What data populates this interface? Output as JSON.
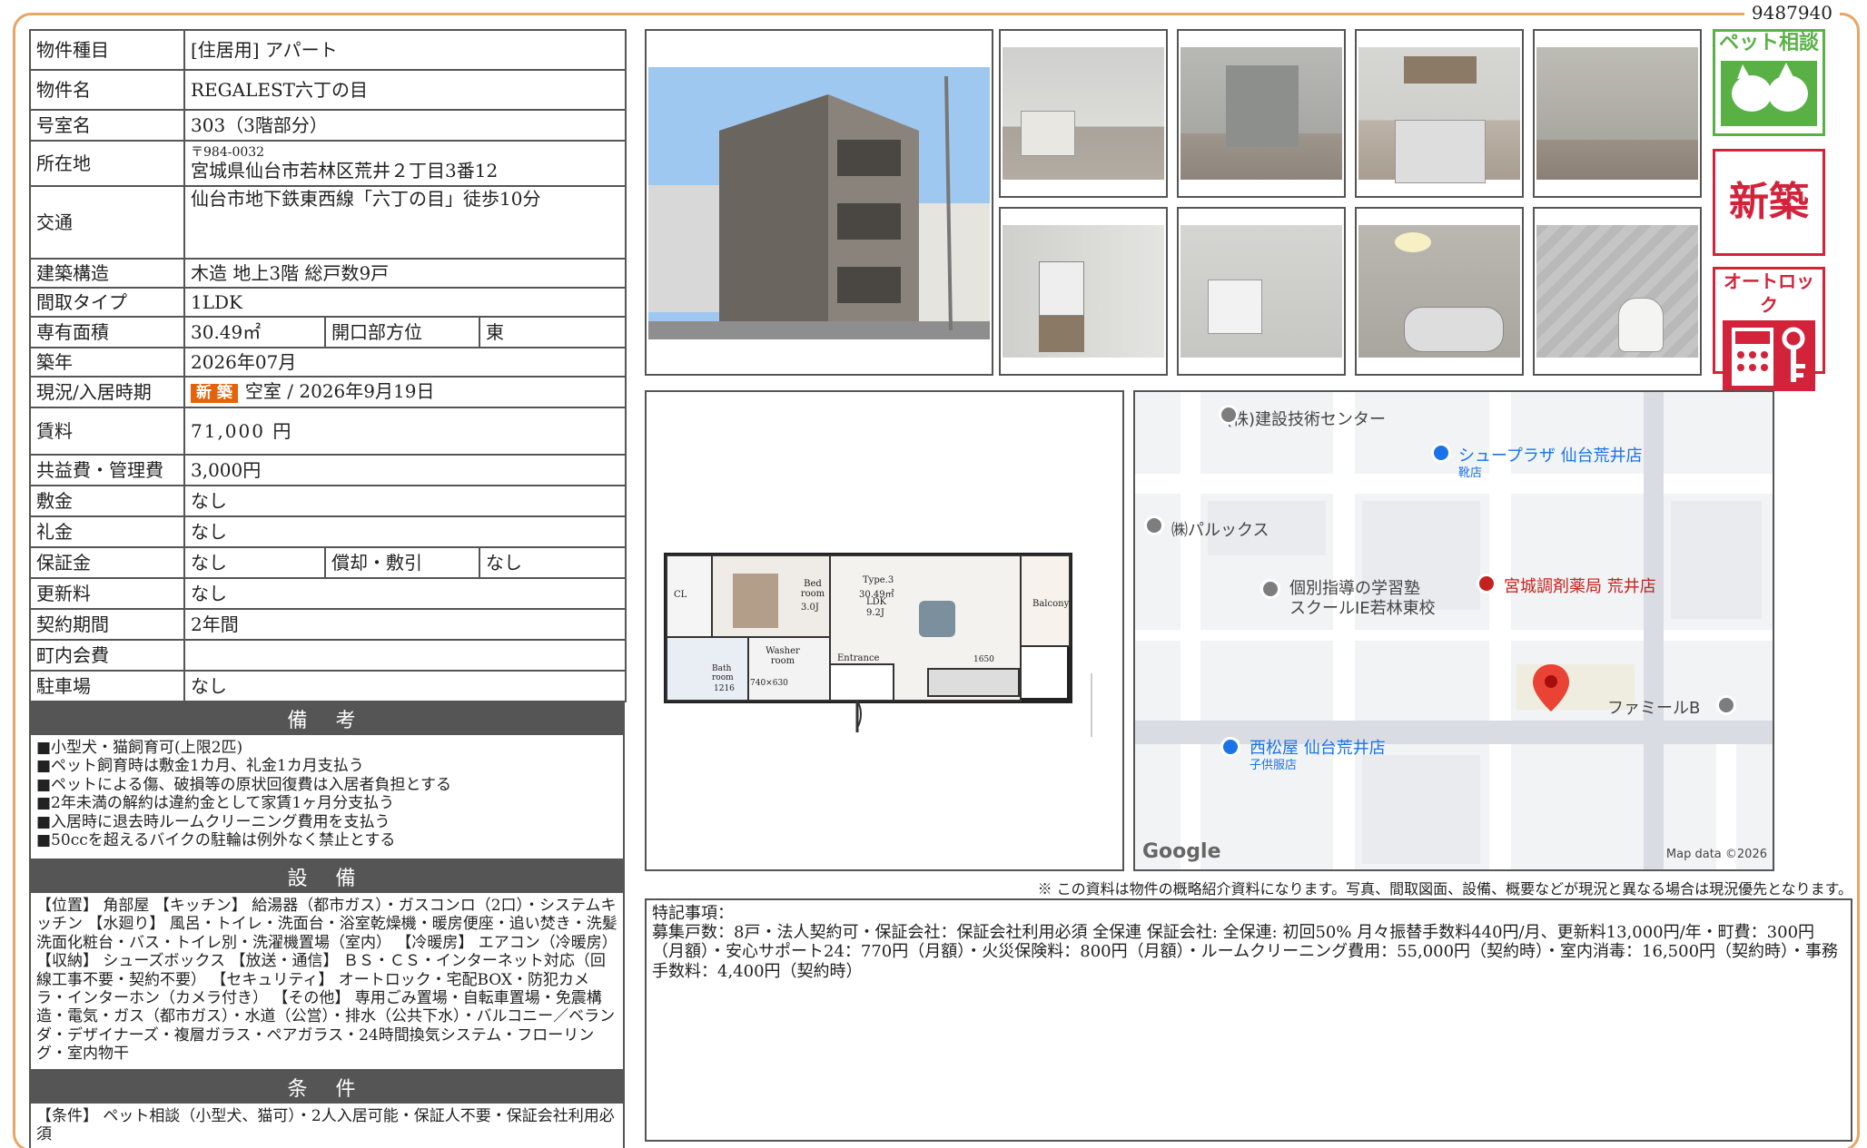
{
  "doc_id": "9487940",
  "table": {
    "type_label": "物件種目",
    "type_value": "[住居用] アパート",
    "name_label": "物件名",
    "name_value": "REGALEST六丁の目",
    "room_label": "号室名",
    "room_value": "303（3階部分）",
    "address_label": "所在地",
    "zip": "〒984-0032",
    "address": "宮城県仙台市若林区荒井２丁目3番12",
    "access_label": "交通",
    "access": "仙台市地下鉄東西線「六丁の目」徒歩10分",
    "structure_label": "建築構造",
    "structure": "木造 地上3階 総戸数9戸",
    "layout_label": "間取タイプ",
    "layout": "1LDK",
    "area_label": "専有面積",
    "area": "30.49㎡",
    "facing_label": "開口部方位",
    "facing": "東",
    "built_label": "築年",
    "built": "2026年07月",
    "status_label": "現況/入居時期",
    "status_badge": "新 築",
    "status": "空室 /  2026年9月19日",
    "rent_label": "賃料",
    "rent": "71,000 円",
    "fee_label": "共益費・管理費",
    "fee": "3,000円",
    "deposit_label": "敷金",
    "deposit": "なし",
    "key_money_label": "礼金",
    "key_money": "なし",
    "guarantee_label": "保証金",
    "guarantee": "なし",
    "amort_label": "償却・敷引",
    "amort": "なし",
    "renewal_label": "更新料",
    "renewal": "なし",
    "contract_label": "契約期間",
    "contract": "2年間",
    "town_fee_label": "町内会費",
    "town_fee": "",
    "parking_label": "駐車場",
    "parking": "なし"
  },
  "biko": {
    "title": "備 考",
    "lines": [
      "■小型犬・猫飼育可(上限2匹)",
      "■ペット飼育時は敷金1カ月、礼金1カ月支払う",
      "■ペットによる傷、破損等の原状回復費は入居者負担とする",
      "■2年未満の解約は違約金として家賃1ヶ月分支払う",
      "■入居時に退去時ルームクリーニング費用を支払う",
      "■50ccを超えるバイクの駐輪は例外なく禁止とする"
    ]
  },
  "setsubi": {
    "title": "設 備",
    "text": "【位置】 角部屋 【キッチン】 給湯器（都市ガス）・ガスコンロ（2口）・システムキッチン 【水廻り】 風呂・トイレ・洗面台・浴室乾燥機・暖房便座・追い焚き・洗髪洗面化粧台・バス・トイレ別・洗濯機置場（室内） 【冷暖房】 エアコン（冷暖房） 【収納】 シューズボックス 【放送・通信】 ＢＳ・ＣＳ・インターネット対応（回線工事不要・契約不要） 【セキュリティ】 オートロック・宅配BOX・防犯カメラ・インターホン（カメラ付き） 【その他】 専用ごみ置場・自転車置場・免震構造・電気・ガス（都市ガス）・水道（公営）・排水（公共下水）・バルコニー／ベランダ・デザイナーズ・複層ガラス・ペアガラス・24時間換気システム・フローリング・室内物干"
  },
  "jouken": {
    "title": "条 件",
    "text": "【条件】 ペット相談（小型犬、猫可）・2人入居可能・保証人不要・保証会社利用必須"
  },
  "badges": {
    "pet": "ペット相談",
    "new": "新築",
    "autolock": "オートロック"
  },
  "floorplan": {
    "type": "Type.3",
    "area": "30.49㎡",
    "ldk": "LDK",
    "ldk_size": "9.2J",
    "bed": "Bed room",
    "bed_size": "3.0J",
    "cl": "CL",
    "washer": "Washer room",
    "entrance": "Entrance",
    "bath": "Bath room",
    "balcony": "Balcony",
    "dim1": "1650",
    "dim2": "1216",
    "dim3": "740×630"
  },
  "map": {
    "labels": {
      "kensetsu": "(株)建設技術センター",
      "shoe": "シュープラザ 仙台荒井店",
      "shoe_sub": "靴店",
      "paruccs": "㈱パルックス",
      "juku1": "個別指導の学習塾",
      "juku2": "スクールIE若林東校",
      "pharmacy": "宮城調剤薬局 荒井店",
      "famil": "ファミールB",
      "nishimatsu": "西松屋 仙台荒井店",
      "nishimatsu_sub": "子供服店",
      "google": "Google",
      "mapdata": "Map data ©2026"
    }
  },
  "note": "※ この資料は物件の概略紹介資料になります。写真、間取図面、設備、概要などが現況と異なる場合は現況優先となります。",
  "remarks": {
    "title": "特記事項：",
    "text": "募集戸数：8戸・法人契約可・保証会社：保証会社利用必須 全保連 保証会社: 全保連: 初回50% 月々振替手数料440円/月、更新料13,000円/年・町費：300円（月額）・安心サポート24：770円（月額）・火災保険料：800円（月額）・ルームクリーニング費用：55,000円（契約時）・室内消毒：16,500円（契約時）・事務手数料：4,400円（契約時）"
  }
}
